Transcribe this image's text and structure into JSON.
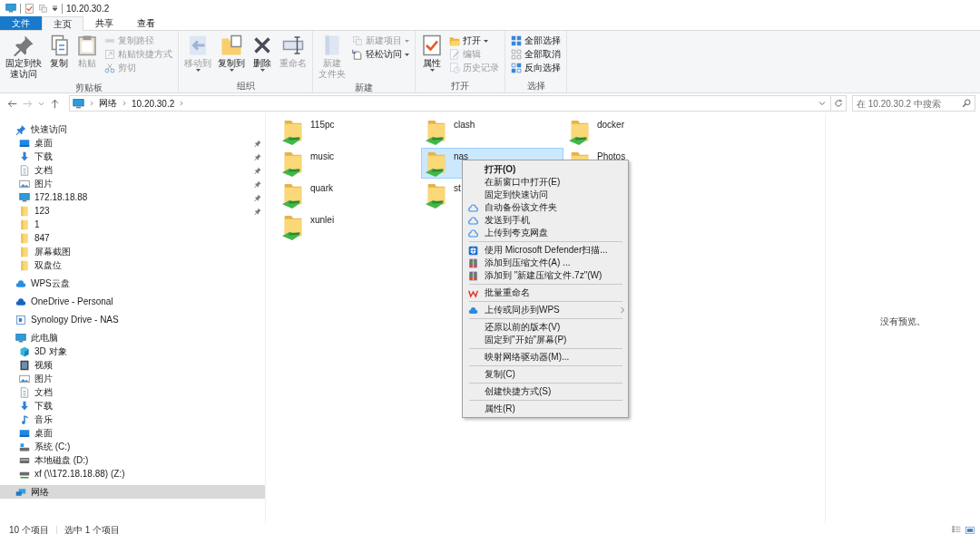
{
  "window": {
    "title": "10.20.30.2"
  },
  "ribbon_tabs": [
    {
      "label": "文件",
      "kind": "file",
      "selected": false
    },
    {
      "label": "主页",
      "kind": "tab",
      "selected": true
    },
    {
      "label": "共享",
      "kind": "tab",
      "selected": false
    },
    {
      "label": "查看",
      "kind": "tab",
      "selected": false
    }
  ],
  "ribbon_groups": [
    {
      "label": "剪贴板",
      "controls": [
        {
          "kind": "large",
          "lines": [
            "固定到快",
            "速访问"
          ],
          "disabled": false,
          "dropdown": false
        },
        {
          "kind": "large",
          "label": "复制",
          "disabled": false,
          "dropdown": false
        },
        {
          "kind": "large",
          "label": "粘贴",
          "disabled": true,
          "dropdown": false
        },
        {
          "kind": "stack",
          "items": [
            {
              "label": "复制路径",
              "disabled": true,
              "dropdown": false
            },
            {
              "label": "粘贴快捷方式",
              "disabled": true,
              "dropdown": false
            },
            {
              "label": "剪切",
              "disabled": true,
              "dropdown": false
            }
          ]
        }
      ]
    },
    {
      "label": "组织",
      "controls": [
        {
          "kind": "large",
          "label": "移动到",
          "disabled": true,
          "dropdown": true
        },
        {
          "kind": "large",
          "label": "复制到",
          "disabled": false,
          "dropdown": true
        },
        {
          "kind": "large",
          "label": "删除",
          "disabled": false,
          "dropdown": true
        },
        {
          "kind": "large",
          "label": "重命名",
          "disabled": true,
          "dropdown": false
        }
      ]
    },
    {
      "label": "新建",
      "controls": [
        {
          "kind": "large",
          "lines": [
            "新建",
            "文件夹"
          ],
          "disabled": true,
          "dropdown": false
        },
        {
          "kind": "stack",
          "items": [
            {
              "label": "新建项目",
              "disabled": true,
              "dropdown": true
            },
            {
              "label": "轻松访问",
              "disabled": false,
              "dropdown": true
            }
          ]
        }
      ]
    },
    {
      "label": "打开",
      "controls": [
        {
          "kind": "large",
          "label": "属性",
          "disabled": false,
          "dropdown": true
        },
        {
          "kind": "stack",
          "items": [
            {
              "label": "打开",
              "disabled": false,
              "dropdown": true
            },
            {
              "label": "编辑",
              "disabled": true,
              "dropdown": false
            },
            {
              "label": "历史记录",
              "disabled": true,
              "dropdown": false
            }
          ]
        }
      ]
    },
    {
      "label": "选择",
      "controls": [
        {
          "kind": "stack",
          "items": [
            {
              "label": "全部选择",
              "disabled": false,
              "dropdown": false
            },
            {
              "label": "全部取消",
              "disabled": false,
              "dropdown": false
            },
            {
              "label": "反向选择",
              "disabled": false,
              "dropdown": false
            }
          ]
        }
      ]
    }
  ],
  "address": {
    "crumbs": [
      "网络",
      "10.20.30.2"
    ]
  },
  "search": {
    "placeholder": "在 10.20.30.2 中搜索"
  },
  "nav": [
    {
      "label": "快速访问",
      "selected": false,
      "children": [
        {
          "label": "桌面",
          "selected": false,
          "pinned": true
        },
        {
          "label": "下载",
          "selected": false,
          "pinned": true
        },
        {
          "label": "文档",
          "selected": false,
          "pinned": true
        },
        {
          "label": "图片",
          "selected": false,
          "pinned": true
        },
        {
          "label": "172.18.18.88",
          "selected": false,
          "pinned": true
        },
        {
          "label": "123",
          "selected": false,
          "pinned": true
        },
        {
          "label": "1",
          "selected": false,
          "pinned": false
        },
        {
          "label": "847",
          "selected": false,
          "pinned": false
        },
        {
          "label": "屏幕截图",
          "selected": false,
          "pinned": false
        },
        {
          "label": "双盘位",
          "selected": false,
          "pinned": false
        }
      ]
    },
    {
      "label": "WPS云盘",
      "selected": false
    },
    {
      "label": "OneDrive - Personal",
      "selected": false
    },
    {
      "label": "Synology Drive - NAS",
      "selected": false
    },
    {
      "label": "此电脑",
      "selected": false,
      "children": [
        {
          "label": "3D 对象",
          "selected": false
        },
        {
          "label": "视频",
          "selected": false
        },
        {
          "label": "图片",
          "selected": false
        },
        {
          "label": "文档",
          "selected": false
        },
        {
          "label": "下载",
          "selected": false
        },
        {
          "label": "音乐",
          "selected": false
        },
        {
          "label": "桌面",
          "selected": false
        },
        {
          "label": "系统 (C:)",
          "selected": false
        },
        {
          "label": "本地磁盘 (D:)",
          "selected": false
        },
        {
          "label": "xf (\\\\172.18.18.88) (Z:)",
          "selected": false
        }
      ]
    },
    {
      "label": "网络",
      "selected": true
    }
  ],
  "folders": {
    "rows": [
      [
        {
          "name": "115pc",
          "selected": false
        },
        {
          "name": "clash",
          "selected": false
        },
        {
          "name": "docker",
          "selected": false
        }
      ],
      [
        {
          "name": "music",
          "selected": false
        },
        {
          "name": "nas",
          "selected": true
        },
        {
          "name": "Photos",
          "selected": false
        }
      ],
      [
        {
          "name": "quark",
          "selected": false
        },
        {
          "name": "st",
          "selected": false
        }
      ],
      [
        {
          "name": "xunlei",
          "selected": false
        }
      ]
    ]
  },
  "context_menu": {
    "sections": [
      [
        {
          "label": "打开(O)",
          "default": true,
          "submenu": false
        },
        {
          "label": "在新窗口中打开(E)",
          "default": false,
          "submenu": false
        },
        {
          "label": "固定到快速访问",
          "default": false,
          "submenu": false
        },
        {
          "label": "自动备份该文件夹",
          "default": false,
          "submenu": false
        },
        {
          "label": "发送到手机",
          "default": false,
          "submenu": false
        },
        {
          "label": "上传到夸克网盘",
          "default": false,
          "submenu": false
        }
      ],
      [
        {
          "label": "使用 Microsoft Defender扫描...",
          "default": false,
          "submenu": false
        },
        {
          "label": "添加到压缩文件(A) ...",
          "default": false,
          "submenu": false
        },
        {
          "label": "添加到 \"新建压缩文件.7z\"(W)",
          "default": false,
          "submenu": false
        }
      ],
      [
        {
          "label": "批量重命名",
          "default": false,
          "submenu": false
        }
      ],
      [
        {
          "label": "上传或同步到WPS",
          "default": false,
          "submenu": true
        }
      ],
      [
        {
          "label": "还原以前的版本(V)",
          "default": false,
          "submenu": false
        },
        {
          "label": "固定到\"开始\"屏幕(P)",
          "default": false,
          "submenu": false
        }
      ],
      [
        {
          "label": "映射网络驱动器(M)...",
          "default": false,
          "submenu": false
        }
      ],
      [
        {
          "label": "复制(C)",
          "default": false,
          "submenu": false
        }
      ],
      [
        {
          "label": "创建快捷方式(S)",
          "default": false,
          "submenu": false
        }
      ],
      [
        {
          "label": "属性(R)",
          "default": false,
          "submenu": false
        }
      ]
    ]
  },
  "preview": {
    "message": "没有预览。"
  },
  "status_bar": {
    "item_count": "10 个项目",
    "selection": "选中 1 个项目"
  }
}
